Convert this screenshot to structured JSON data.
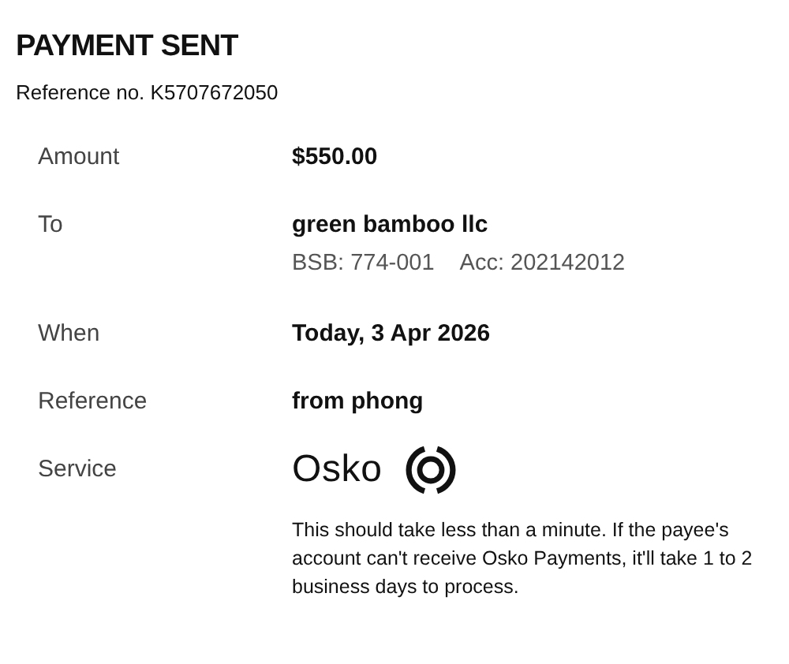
{
  "title": "PAYMENT SENT",
  "reference_no": "Reference no. K5707672050",
  "details": [
    {
      "kind": "text",
      "label": "Amount",
      "value": "$550.00"
    },
    {
      "kind": "payee",
      "label": "To",
      "value": "green bamboo llc",
      "bsb": "BSB: 774-001",
      "acc": "Acc: 202142012"
    },
    {
      "kind": "text",
      "label": "When",
      "value": "Today, 3 Apr 2026"
    },
    {
      "kind": "text",
      "label": "Reference",
      "value": "from phong"
    },
    {
      "kind": "service",
      "label": "Service",
      "brand": "Osko",
      "note": "This should take less than a minute. If the payee's account can't receive Osko Payments, it'll take 1 to 2 business days to process."
    }
  ]
}
